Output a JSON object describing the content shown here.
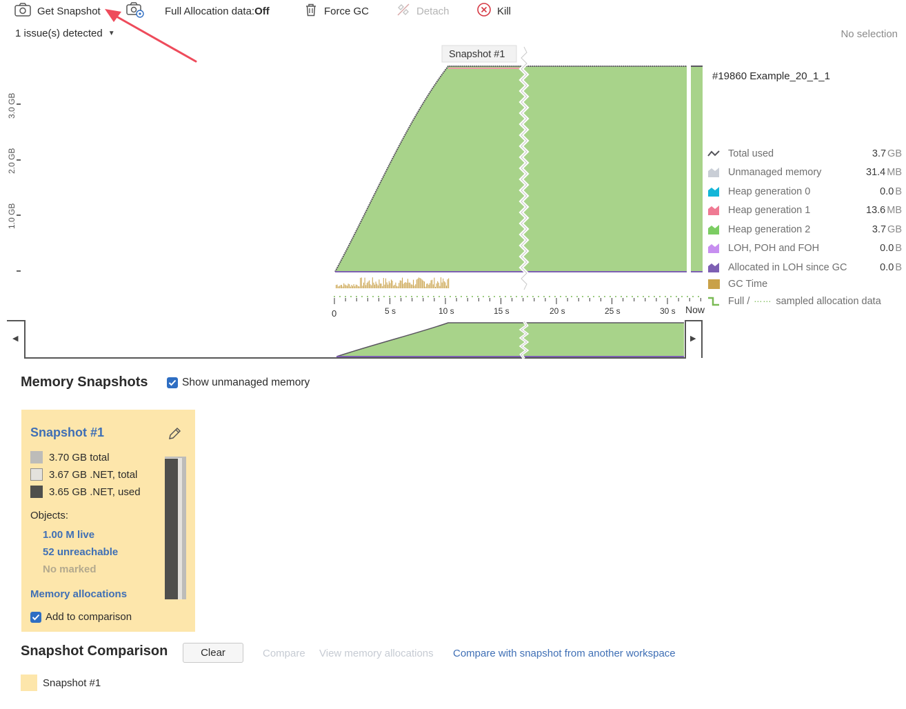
{
  "toolbar": {
    "get_snapshot": "Get Snapshot",
    "full_alloc_label": "Full Allocation data:",
    "full_alloc_value": "Off",
    "force_gc": "Force GC",
    "detach": "Detach",
    "kill": "Kill"
  },
  "issues": "1 issue(s) detected",
  "selection": "No selection",
  "timeline": {
    "snapshot_marker": "Snapshot #1",
    "process_name": "#19860 Example_20_1_1",
    "y_ticks": [
      "3.0 GB",
      "2.0 GB",
      "1.0 GB"
    ],
    "x_ticks": [
      "0",
      "5 s",
      "10 s",
      "15 s",
      "20 s",
      "25 s",
      "30 s",
      "Now"
    ]
  },
  "legend": [
    {
      "label": "Total used",
      "value": "3.7",
      "unit": "GB",
      "color": "#55555a",
      "icon": "line-icon"
    },
    {
      "label": "Unmanaged memory",
      "value": "31.4",
      "unit": "MB",
      "color": "#c9ced6",
      "icon": "area-icon"
    },
    {
      "label": "Heap generation 0",
      "value": "0.0",
      "unit": "B",
      "color": "#14b6d8",
      "icon": "area-icon"
    },
    {
      "label": "Heap generation 1",
      "value": "13.6",
      "unit": "MB",
      "color": "#ef7a93",
      "icon": "area-icon"
    },
    {
      "label": "Heap generation 2",
      "value": "3.7",
      "unit": "GB",
      "color": "#7ccd63",
      "icon": "area-icon"
    },
    {
      "label": "LOH, POH and FOH",
      "value": "0.0",
      "unit": "B",
      "color": "#c78ff0",
      "icon": "area-icon"
    },
    {
      "label": "Allocated in LOH since GC",
      "value": "0.0",
      "unit": "B",
      "color": "#7d5fb3",
      "icon": "area-icon"
    },
    {
      "label": "GC Time",
      "value": "",
      "unit": "",
      "color": "#c9a148",
      "icon": "bar-icon"
    }
  ],
  "legend_alloc": {
    "full": "Full /",
    "sampled": "sampled allocation data"
  },
  "snapshots_section": {
    "title": "Memory Snapshots",
    "show_unmanaged": "Show unmanaged memory"
  },
  "snapshot_card": {
    "title": "Snapshot #1",
    "total": "3.70 GB total",
    "net_total": "3.67 GB .NET, total",
    "net_used": "3.65 GB .NET, used",
    "objects_label": "Objects:",
    "live": "1.00 M live",
    "unreachable": "52 unreachable",
    "marked": "No marked",
    "allocations": "Memory allocations",
    "add_comparison": "Add to comparison"
  },
  "comparison": {
    "title": "Snapshot Comparison",
    "clear": "Clear",
    "compare": "Compare",
    "view_alloc": "View memory allocations",
    "compare_other": "Compare with snapshot from another workspace",
    "snapshot_item": "Snapshot #1"
  }
}
